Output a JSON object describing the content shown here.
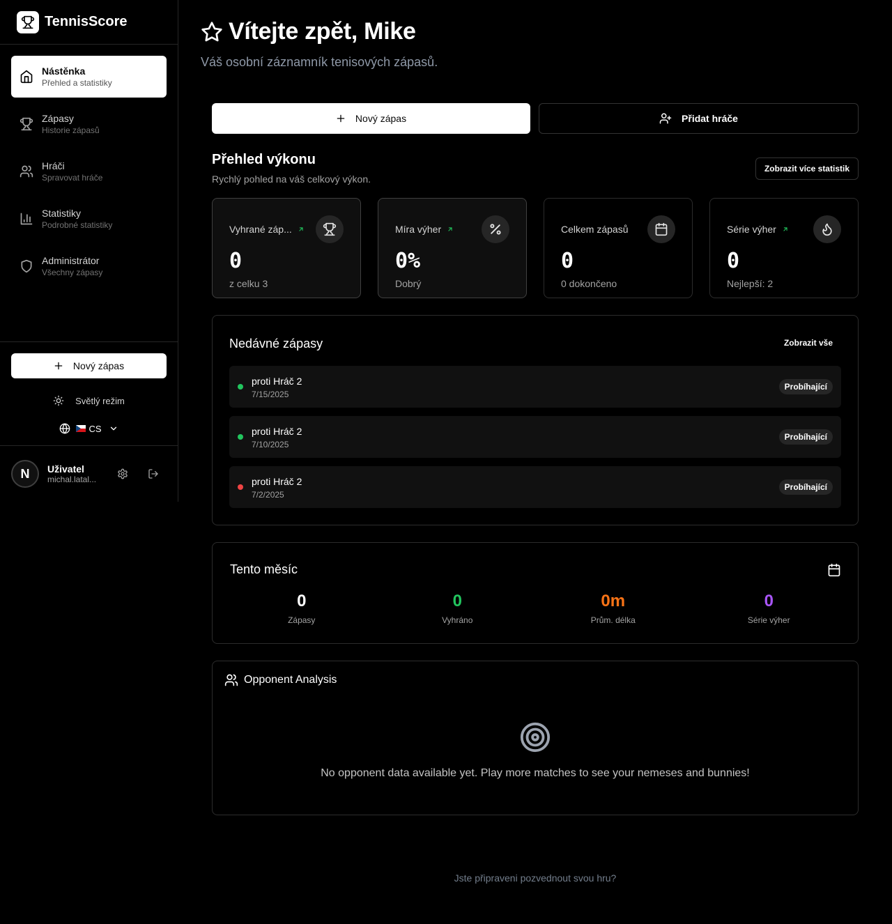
{
  "brand": {
    "name": "TennisScore"
  },
  "sidebar": {
    "items": [
      {
        "label": "Nástěnka",
        "sub": "Přehled a statistiky",
        "icon": "home-icon",
        "active": true
      },
      {
        "label": "Zápasy",
        "sub": "Historie zápasů",
        "icon": "trophy-icon"
      },
      {
        "label": "Hráči",
        "sub": "Spravovat hráče",
        "icon": "users-icon"
      },
      {
        "label": "Statistiky",
        "sub": "Podrobné statistiky",
        "icon": "bar-chart-icon"
      },
      {
        "label": "Administrátor",
        "sub": "Všechny zápasy",
        "icon": "shield-icon"
      }
    ],
    "new_match": "Nový zápas",
    "theme_toggle": "Světlý režim",
    "language": "CS",
    "user": {
      "avatar_letter": "N",
      "name": "Uživatel",
      "email": "michal.latal..."
    }
  },
  "header": {
    "title": "Vítejte zpět, Mike",
    "subtitle": "Váš osobní záznamník tenisových zápasů."
  },
  "actions": {
    "new_match": "Nový zápas",
    "add_player": "Přidat hráče"
  },
  "performance": {
    "title": "Přehled výkonu",
    "subtitle": "Rychlý pohled na váš celkový výkon.",
    "more_button": "Zobrazit více statistik",
    "cards": [
      {
        "label": "Vyhrané záp...",
        "value": "0",
        "sub": "z celku 3",
        "icon": "trophy-icon",
        "trend": true
      },
      {
        "label": "Míra výher",
        "value": "0%",
        "sub": "Dobrý",
        "icon": "percent-icon",
        "trend": true
      },
      {
        "label": "Celkem zápasů",
        "value": "0",
        "sub": "0 dokončeno",
        "icon": "calendar-icon",
        "trend": false
      },
      {
        "label": "Série výher",
        "value": "0",
        "sub": "Nejlepší: 2",
        "icon": "flame-icon",
        "trend": true
      }
    ]
  },
  "recent": {
    "title": "Nedávné zápasy",
    "view_all": "Zobrazit vše",
    "matches": [
      {
        "opponent": "proti Hráč 2",
        "date": "7/15/2025",
        "status": "Probíhající",
        "dot_color": "#22c55e"
      },
      {
        "opponent": "proti Hráč 2",
        "date": "7/10/2025",
        "status": "Probíhající",
        "dot_color": "#22c55e"
      },
      {
        "opponent": "proti Hráč 2",
        "date": "7/2/2025",
        "status": "Probíhající",
        "dot_color": "#ef4444"
      }
    ]
  },
  "month": {
    "title": "Tento měsíc",
    "stats": [
      {
        "value": "0",
        "label": "Zápasy",
        "color": "#ffffff"
      },
      {
        "value": "0",
        "label": "Vyhráno",
        "color": "#22c55e"
      },
      {
        "value": "0m",
        "label": "Prům. délka",
        "color": "#f97316"
      },
      {
        "value": "0",
        "label": "Série výher",
        "color": "#a855f7"
      }
    ]
  },
  "opponents": {
    "title": "Opponent Analysis",
    "empty": "No opponent data available yet. Play more matches to see your nemeses and bunnies!"
  },
  "footer": {
    "text": "Jste připraveni pozvednout svou hru?"
  }
}
